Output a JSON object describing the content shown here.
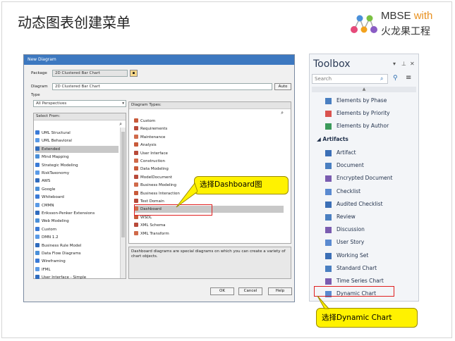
{
  "slide": {
    "title": "动态图表创建菜单",
    "logo": {
      "brand": "MBSE",
      "with": "with",
      "company": "火龙果工程"
    }
  },
  "dialog": {
    "window_title": "New Diagram",
    "package_label": "Package",
    "package_value": "2D Clustered Bar Chart",
    "diagram_label": "Diagram",
    "diagram_value": "2D Clustered Bar Chart",
    "auto_button": "Auto",
    "type_label": "Type",
    "perspective": "All Perspectives",
    "select_from_header": "Select From:",
    "diagram_types_header": "Diagram Types:",
    "select_from": [
      "UML Structural",
      "UML Behavioral",
      "Extended",
      "Mind Mapping",
      "Strategic Modeling",
      "RiskTaxonomy",
      "AWS",
      "Google",
      "Whiteboard",
      "CMMN",
      "Eriksson-Penker Extensions",
      "Web Modeling",
      "Custom",
      "DMN 1.2",
      "Business Rule Model",
      "Data Flow Diagrams",
      "Wireframing",
      "IFML",
      "User Interface - Simple"
    ],
    "diagram_types": [
      "Custom",
      "Requirements",
      "Maintenance",
      "Analysis",
      "User Interface",
      "Construction",
      "Data Modeling",
      "ModelDocument",
      "Business Modeling",
      "Business Interaction",
      "Test Domain",
      "Dashboard",
      "WSDL",
      "XML Schema",
      "XML Transform"
    ],
    "description": "Dashboard diagrams are special diagrams on which you can create a variety of chart objects.",
    "ok": "OK",
    "cancel": "Cancel",
    "help": "Help"
  },
  "callouts": {
    "dashboard": "选择Dashboard图",
    "dynamic_chart": "选择Dynamic Chart"
  },
  "toolbox": {
    "title": "Toolbox",
    "search_placeholder": "Search",
    "items_top": [
      "Elements by Phase",
      "Elements by Priority",
      "Elements by Author"
    ],
    "group": "Artifacts",
    "items": [
      "Artifact",
      "Document",
      "Encrypted Document",
      "Checklist",
      "Audited Checklist",
      "Review",
      "Discussion",
      "User Story",
      "Working Set",
      "Standard Chart",
      "Time Series Chart",
      "Dynamic Chart"
    ]
  },
  "colors": {
    "callout": "#fff200",
    "highlight": "#e02020",
    "titlebar": "#3c78c0"
  }
}
